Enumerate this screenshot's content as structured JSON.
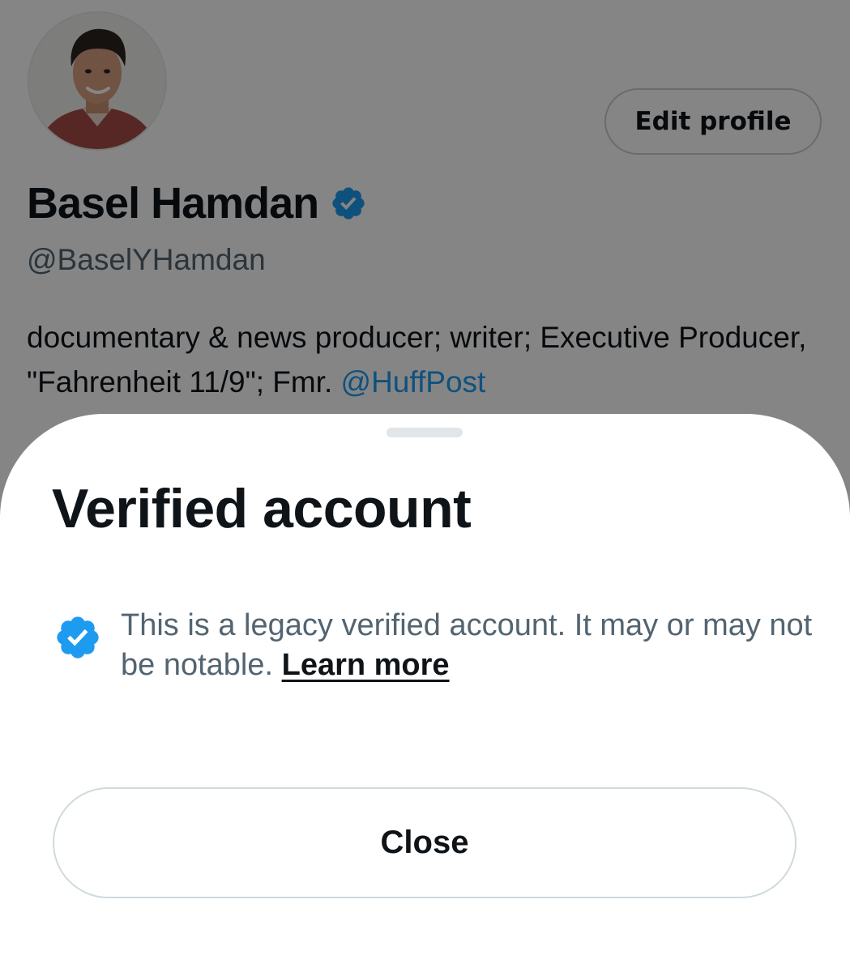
{
  "profile": {
    "name": "Basel Hamdan",
    "handle": "@BaselYHamdan",
    "bio_text": "documentary & news producer; writer; Executive Producer, \"Fahrenheit 11/9\"; Fmr. ",
    "bio_mention": "@HuffPost",
    "edit_profile_label": "Edit profile"
  },
  "sheet": {
    "title": "Verified account",
    "message": "This is a legacy verified account. It may or may not be notable. ",
    "learn_more_label": "Learn more",
    "close_label": "Close"
  },
  "colors": {
    "verified_badge": "#1d9bf0",
    "mention": "#1d9bf0",
    "text_primary": "#0f1419",
    "text_secondary": "#536471"
  },
  "icons": {
    "name_badge": "verified-badge-icon",
    "sheet_badge": "verified-badge-icon"
  }
}
